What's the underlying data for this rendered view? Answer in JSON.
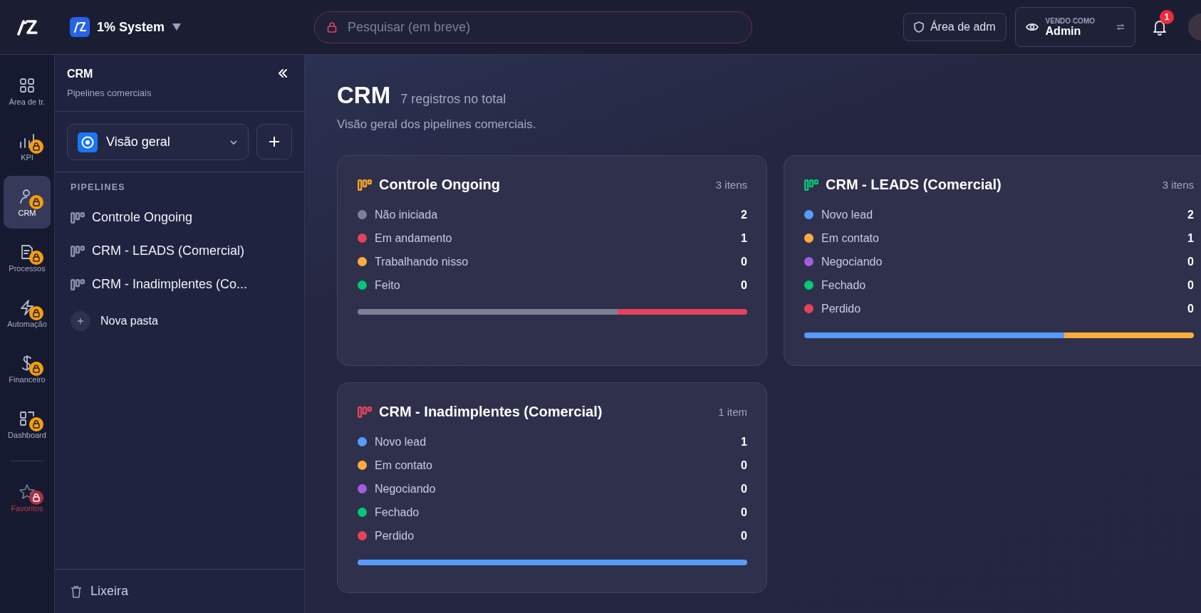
{
  "topbar": {
    "brand": "1% System",
    "search": {
      "placeholder": "Pesquisar (em breve)"
    },
    "admin_button": "Área de adm",
    "viewing_as": {
      "label": "VENDO COMO",
      "value": "Admin"
    },
    "notifications": {
      "count": "1"
    }
  },
  "rail": {
    "items": [
      {
        "label": "Área de tr.",
        "locked": false,
        "selected": false
      },
      {
        "label": "KPI",
        "locked": true,
        "selected": false
      },
      {
        "label": "CRM",
        "locked": true,
        "selected": true
      },
      {
        "label": "Processos",
        "locked": true,
        "selected": false
      },
      {
        "label": "Automação",
        "locked": true,
        "selected": false
      },
      {
        "label": "Financeiro",
        "locked": true,
        "selected": false
      },
      {
        "label": "Dashboard",
        "locked": true,
        "selected": false
      }
    ],
    "favorites": {
      "label": "Favoritos",
      "locked": true
    }
  },
  "sidebar": {
    "title": "CRM",
    "subtitle": "Pipelines comerciais",
    "view_select": {
      "value": "Visão geral"
    },
    "section": "PIPELINES",
    "items": [
      "Controle Ongoing",
      "CRM - LEADS (Comercial)",
      "CRM - Inadimplentes (Co..."
    ],
    "new_folder": "Nova pasta",
    "trash": "Lixeira"
  },
  "main": {
    "title": "CRM",
    "count": "7 registros no total",
    "subtitle": "Visão geral dos pipelines comerciais.",
    "cards": [
      {
        "title": "Controle Ongoing",
        "color": "#f5a623",
        "count": "3 itens",
        "statuses": [
          {
            "label": "Não iniciada",
            "value": "2",
            "color": "#7d8196",
            "level": 0.667
          },
          {
            "label": "Em andamento",
            "value": "1",
            "color": "#e2445c",
            "level": 0.333
          },
          {
            "label": "Trabalhando nisso",
            "value": "0",
            "color": "#fdab3d"
          },
          {
            "label": "Feito",
            "value": "0",
            "color": "#00c875"
          }
        ]
      },
      {
        "title": "CRM - LEADS (Comercial)",
        "color": "#00c875",
        "count": "3 itens",
        "statuses": [
          {
            "label": "Novo lead",
            "value": "2",
            "color": "#579bfc",
            "level": 0.667
          },
          {
            "label": "Em contato",
            "value": "1",
            "color": "#fdab3d",
            "level": 0.333
          },
          {
            "label": "Negociando",
            "value": "0",
            "color": "#a25ddc"
          },
          {
            "label": "Fechado",
            "value": "0",
            "color": "#00c875"
          },
          {
            "label": "Perdido",
            "value": "0",
            "color": "#e2445c"
          }
        ]
      },
      {
        "title": "CRM - Inadimplentes (Comercial)",
        "color": "#e2445c",
        "count": "1 item",
        "statuses": [
          {
            "label": "Novo lead",
            "value": "1",
            "color": "#579bfc",
            "level": 1
          },
          {
            "label": "Em contato",
            "value": "0",
            "color": "#fdab3d"
          },
          {
            "label": "Negociando",
            "value": "0",
            "color": "#a25ddc"
          },
          {
            "label": "Fechado",
            "value": "0",
            "color": "#00c875"
          },
          {
            "label": "Perdido",
            "value": "0",
            "color": "#e2445c"
          }
        ]
      }
    ]
  }
}
